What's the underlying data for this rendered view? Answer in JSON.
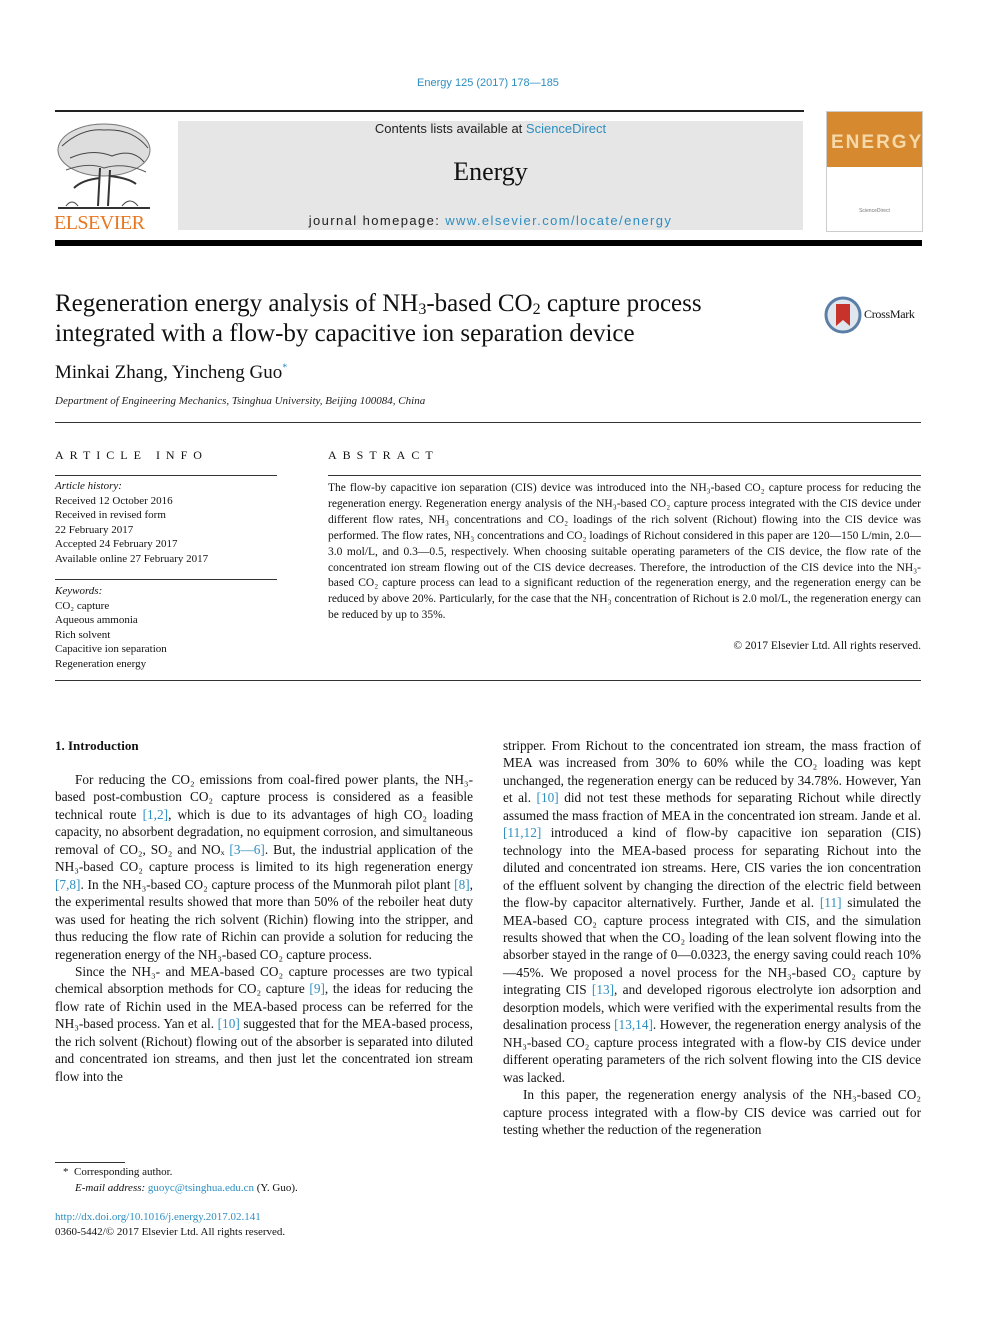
{
  "header": {
    "citation": "Energy 125 (2017) 178—185",
    "contents_prefix": "Contents lists available at ",
    "contents_link": "ScienceDirect",
    "journal_name": "Energy",
    "homepage_prefix": "journal homepage: ",
    "homepage_link": "www.elsevier.com/locate/energy",
    "publisher_logo_text": "ELSEVIER",
    "cover_title": "ENERGY",
    "cover_footer": "ScienceDirect",
    "colors": {
      "link": "#2e8ec0",
      "publisher_orange": "#e87722",
      "cover_orange": "#d6892f",
      "masthead_gray": "#e6e6e6"
    }
  },
  "article": {
    "title_part1": "Regeneration energy analysis of NH",
    "title_sub1": "3",
    "title_part2": "-based CO",
    "title_sub2": "2",
    "title_part3": " capture process integrated with a flow-by capacitive ion separation device",
    "crossmark_label": "CrossMark",
    "authors": "Minkai Zhang, Yincheng Guo",
    "corresponding_marker": "*",
    "affiliation": "Department of Engineering Mechanics, Tsinghua University, Beijing 100084, China"
  },
  "article_info": {
    "heading": "ARTICLE INFO",
    "history_label": "Article history:",
    "history": [
      "Received 12 October 2016",
      "Received in revised form",
      "22 February 2017",
      "Accepted 24 February 2017",
      "Available online 27 February 2017"
    ],
    "keywords_label": "Keywords:",
    "keywords": [
      "CO₂ capture",
      "Aqueous ammonia",
      "Rich solvent",
      "Capacitive ion separation",
      "Regeneration energy"
    ]
  },
  "abstract": {
    "heading": "ABSTRACT",
    "text": "The flow-by capacitive ion separation (CIS) device was introduced into the NH₃-based CO₂ capture process for reducing the regeneration energy. Regeneration energy analysis of the NH₃-based CO₂ capture process integrated with the CIS device under different flow rates, NH₃ concentrations and CO₂ loadings of the rich solvent (Richout) flowing into the CIS device was performed. The flow rates, NH₃ concentrations and CO₂ loadings of Richout considered in this paper are 120—150 L/min, 2.0—3.0 mol/L, and 0.3—0.5, respectively. When choosing suitable operating parameters of the CIS device, the flow rate of the concentrated ion stream flowing out of the CIS device decreases. Therefore, the introduction of the CIS device into the NH₃-based CO₂ capture process can lead to a significant reduction of the regeneration energy, and the regeneration energy can be reduced by above 20%. Particularly, for the case that the NH₃ concentration of Richout is 2.0 mol/L, the regeneration energy can be reduced by up to 35%.",
    "copyright": "© 2017 Elsevier Ltd. All rights reserved."
  },
  "body": {
    "section_heading": "1.  Introduction",
    "left_column": [
      "For reducing the CO₂ emissions from coal-fired power plants, the NH₃-based post-combustion CO₂ capture process is considered as a feasible technical route [1,2], which is due to its advantages of high CO₂ loading capacity, no absorbent degradation, no equipment corrosion, and simultaneous removal of CO₂, SO₂ and NOₓ [3—6]. But, the industrial application of the NH₃-based CO₂ capture process is limited to its high regeneration energy [7,8]. In the NH₃-based CO₂ capture process of the Munmorah pilot plant [8], the experimental results showed that more than 50% of the reboiler heat duty was used for heating the rich solvent (Richin) flowing into the stripper, and thus reducing the flow rate of Richin can provide a solution for reducing the regeneration energy of the NH₃-based CO₂ capture process.",
      "Since the NH₃- and MEA-based CO₂ capture processes are two typical chemical absorption methods for CO₂ capture [9], the ideas for reducing the flow rate of Richin used in the MEA-based process can be referred for the NH₃-based process. Yan et al. [10] suggested that for the MEA-based process, the rich solvent (Richout) flowing out of the absorber is separated into diluted and concentrated ion streams, and then just let the concentrated ion stream flow into the"
    ],
    "right_column": [
      "stripper. From Richout to the concentrated ion stream, the mass fraction of MEA was increased from 30% to 60% while the CO₂ loading was kept unchanged, the regeneration energy can be reduced by 34.78%. However, Yan et al. [10] did not test these methods for separating Richout while directly assumed the mass fraction of MEA in the concentrated ion stream. Jande et al. [11,12] introduced a kind of flow-by capacitive ion separation (CIS) technology into the MEA-based process for separating Richout into the diluted and concentrated ion streams. Here, CIS varies the ion concentration of the effluent solvent by changing the direction of the electric field between the flow-by capacitor alternatively. Further, Jande et al. [11] simulated the MEA-based CO₂ capture process integrated with CIS, and the simulation results showed that when the CO₂ loading of the lean solvent flowing into the absorber stayed in the range of 0—0.0323, the energy saving could reach 10%—45%. We proposed a novel process for the NH₃-based CO₂ capture by integrating CIS [13], and developed rigorous electrolyte ion adsorption and desorption models, which were verified with the experimental results from the desalination process [13,14]. However, the regeneration energy analysis of the NH₃-based CO₂ capture process integrated with a flow-by CIS device under different operating parameters of the rich solvent flowing into the CIS device was lacked.",
      "In this paper, the regeneration energy analysis of the NH₃-based CO₂ capture process integrated with a flow-by CIS device was carried out for testing whether the reduction of the regeneration"
    ],
    "citation_links": [
      "[1,2]",
      "[3—6]",
      "[7,8]",
      "[8]",
      "[9]",
      "[10]",
      "[11,12]",
      "[11]",
      "[13]",
      "[13,14]"
    ]
  },
  "footer": {
    "corresponding_marker": "*",
    "corresponding_label": "Corresponding author.",
    "email_label": "E-mail address:",
    "email": "guoyc@tsinghua.edu.cn",
    "email_suffix": " (Y. Guo).",
    "doi": "http://dx.doi.org/10.1016/j.energy.2017.02.141",
    "issn_copyright": "0360-5442/© 2017 Elsevier Ltd. All rights reserved."
  }
}
